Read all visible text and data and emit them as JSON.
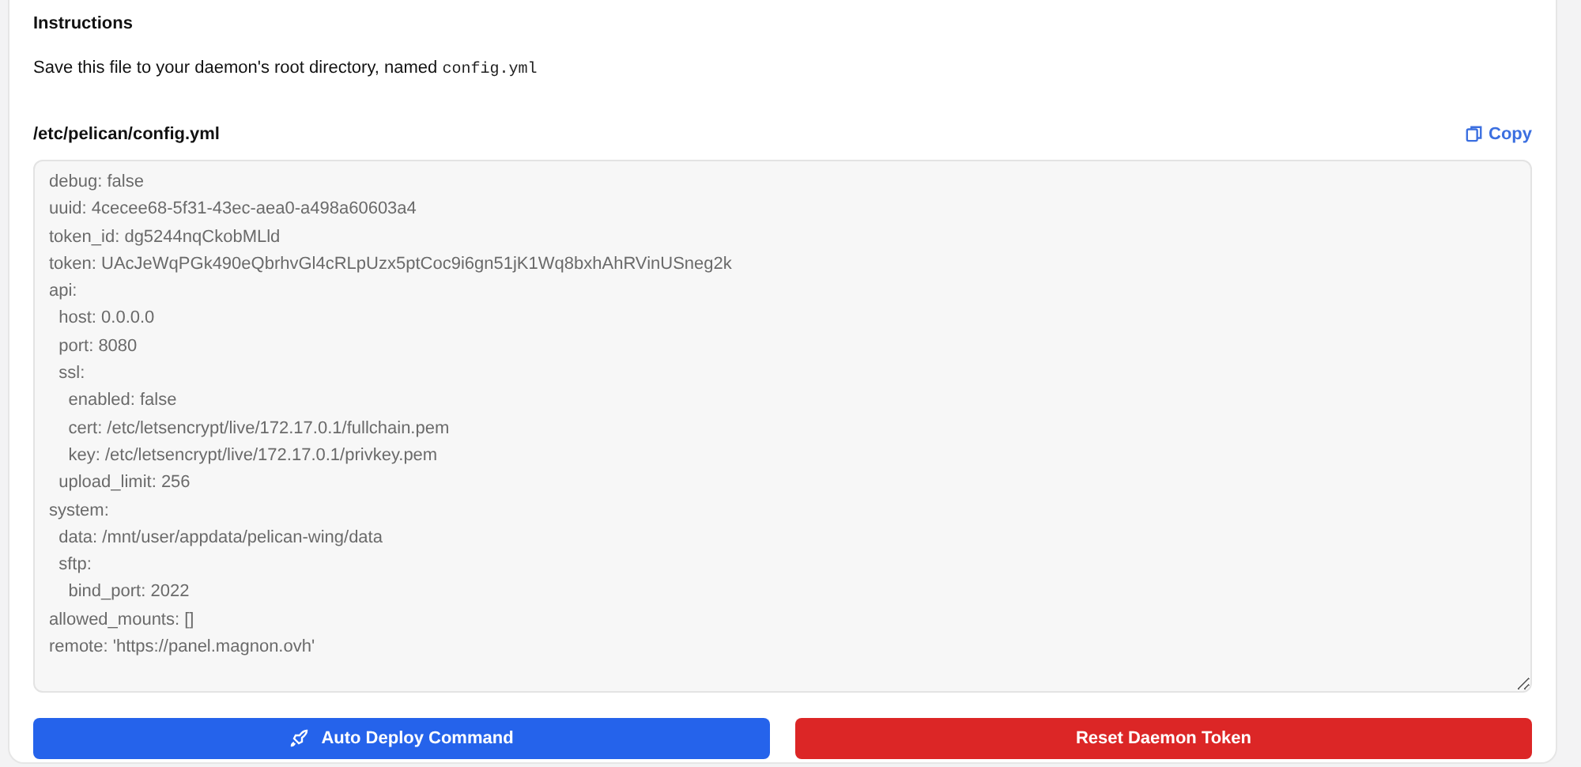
{
  "section": {
    "title": "Instructions",
    "text_before": "Save this file to your daemon's root directory, named",
    "filename_code": "config.yml"
  },
  "file": {
    "path": "/etc/pelican/config.yml",
    "copy_label": "Copy",
    "lines": [
      "debug: false",
      "uuid: 4cecee68-5f31-43ec-aea0-a498a60603a4",
      "token_id: dg5244nqCkobMLld",
      "token: UAcJeWqPGk490eQbrhvGl4cRLpUzx5ptCoc9i6gn51jK1Wq8bxhAhRVinUSneg2k",
      "api:",
      "  host: 0.0.0.0",
      "  port: 8080",
      "  ssl:",
      "    enabled: false",
      "    cert: /etc/letsencrypt/live/172.17.0.1/fullchain.pem",
      "    key: /etc/letsencrypt/live/172.17.0.1/privkey.pem",
      "  upload_limit: 256",
      "system:",
      "  data: /mnt/user/appdata/pelican-wing/data",
      "  sftp:",
      "    bind_port: 2022",
      "allowed_mounts: []",
      "remote: 'https://panel.magnon.ovh'"
    ]
  },
  "buttons": [
    {
      "label": "Auto Deploy Command",
      "kind": "primary"
    },
    {
      "label": "Reset Daemon Token",
      "kind": "danger"
    }
  ]
}
